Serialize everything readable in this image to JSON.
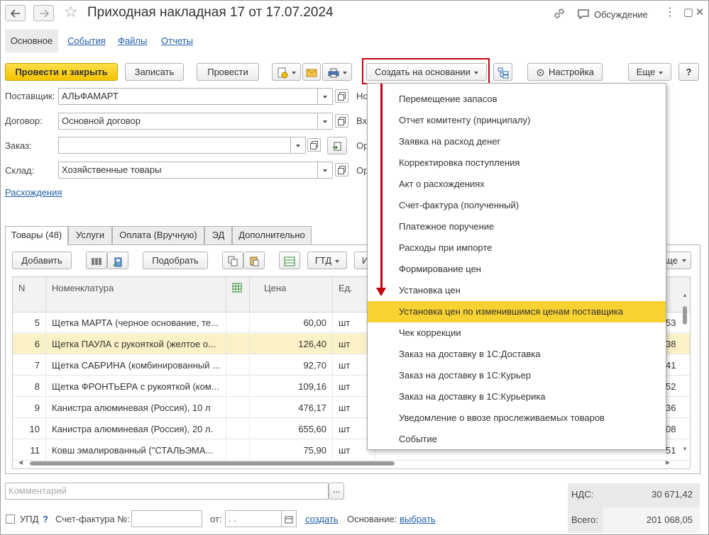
{
  "header": {
    "title": "Приходная накладная 17 от 17.07.2024",
    "discussion_label": "Обсуждение"
  },
  "section_tabs": [
    "Основное",
    "События",
    "Файлы",
    "Отчеты"
  ],
  "toolbar": {
    "post_close": "Провести и закрыть",
    "save": "Записать",
    "post": "Провести",
    "create_based": "Создать на основании",
    "settings": "Настройка",
    "more": "Еще",
    "help": "?"
  },
  "form": {
    "supplier_label": "Поставщик:",
    "supplier_value": "АЛЬФАМАРТ",
    "contract_label": "Договор:",
    "contract_value": "Основной договор",
    "order_label": "Заказ:",
    "order_value": "",
    "warehouse_label": "Склад:",
    "warehouse_value": "Хозяйственные товары",
    "discrepancies_link": "Расхождения",
    "right_labels": [
      "Но",
      "Вх",
      "Ор",
      "Ор"
    ]
  },
  "inner_tabs": [
    "Товары (48)",
    "Услуги",
    "Оплата (Вручную)",
    "ЭД",
    "Дополнительно"
  ],
  "grid_toolbar": {
    "add": "Добавить",
    "pick": "Подобрать",
    "gtd": "ГТД",
    "partial_left": "И",
    "partial_right": "ще"
  },
  "grid": {
    "columns": [
      "N",
      "Номенклатура",
      "",
      "Цена",
      "Ед."
    ],
    "rows": [
      {
        "n": "5",
        "name": "Щетка МАРТА (черное основание, те...",
        "price": "60,00",
        "unit": "шт",
        "tail": "53",
        "selected": false
      },
      {
        "n": "6",
        "name": "Щетка ПАУЛА  с рукояткой (желтое о...",
        "price": "126,40",
        "unit": "шт",
        "tail": "38",
        "selected": true
      },
      {
        "n": "7",
        "name": "Щетка САБРИНА (комбинированный ...",
        "price": "92,70",
        "unit": "шт",
        "tail": "41",
        "selected": false
      },
      {
        "n": "8",
        "name": "Щетка ФРОНТЬЕРА с рукояткой (ком...",
        "price": "109,16",
        "unit": "шт",
        "tail": "52",
        "selected": false
      },
      {
        "n": "9",
        "name": "Канистра алюминевая (Россия), 10 л",
        "price": "476,17",
        "unit": "шт",
        "tail": "36",
        "selected": false
      },
      {
        "n": "10",
        "name": "Канистра алюминевая (Россия), 20 л.",
        "price": "655,60",
        "unit": "шт",
        "tail": "08",
        "selected": false
      },
      {
        "n": "11",
        "name": "Ковш эмалированный (\"СТАЛЬЭМА...",
        "price": "75,90",
        "unit": "шт",
        "tail": "51",
        "selected": false
      }
    ]
  },
  "menu": {
    "items": [
      "Перемещение запасов",
      "Отчет комитенту (принципалу)",
      "Заявка на расход денег",
      "Корректировка поступления",
      "Акт о расхождениях",
      "Счет-фактура (полученный)",
      "Платежное поручение",
      "Расходы при импорте",
      "Формирование цен",
      "Установка цен",
      "Установка цен по изменившимся ценам поставщика",
      "Чек коррекции",
      "Заказ на доставку в 1С:Доставка",
      "Заказ на доставку в 1С:Курьер",
      "Заказ на доставку в 1С:Курьерика",
      "Уведомление о ввозе прослеживаемых товаров",
      "Событие"
    ],
    "highlighted_index": 10,
    "highlight_color": "#f8d231"
  },
  "footer": {
    "comment_placeholder": "Комментарий",
    "comment_btn": "...",
    "upd_label": "УПД",
    "upd_help": "?",
    "invoice_label": "Счет-фактура №:",
    "from_label": "от:",
    "date_placeholder": " .  .",
    "create_link": "создать",
    "basis_label": "Основание:",
    "choose_link": "выбрать",
    "vat_label": "НДС:",
    "vat_value": "30 671,42",
    "total_label": "Всего:",
    "total_value": "201 068,05"
  },
  "colors": {
    "accent_yellow": "#f3c300",
    "link_blue": "#1f5fa8",
    "highlight_red": "#c4000b",
    "selected_row": "#fbf1c6"
  }
}
